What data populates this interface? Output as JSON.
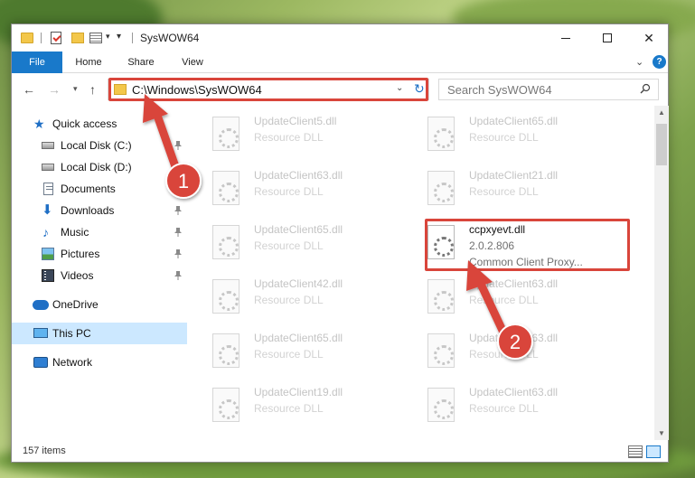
{
  "window": {
    "title": "SysWOW64"
  },
  "ribbon": {
    "tabs": [
      {
        "label": "File"
      },
      {
        "label": "Home"
      },
      {
        "label": "Share"
      },
      {
        "label": "View"
      }
    ],
    "help": "?"
  },
  "address": {
    "path": "C:\\Windows\\SysWOW64"
  },
  "search": {
    "placeholder": "Search SysWOW64"
  },
  "sidebar": {
    "items": [
      {
        "label": "Quick access",
        "icon": "star-icon"
      },
      {
        "label": "Local Disk (C:)",
        "icon": "drive-icon"
      },
      {
        "label": "Local Disk (D:)",
        "icon": "drive-icon"
      },
      {
        "label": "Documents",
        "icon": "documents-icon"
      },
      {
        "label": "Downloads",
        "icon": "download-icon"
      },
      {
        "label": "Music",
        "icon": "music-icon"
      },
      {
        "label": "Pictures",
        "icon": "pictures-icon"
      },
      {
        "label": "Videos",
        "icon": "videos-icon"
      },
      {
        "label": "OneDrive",
        "icon": "cloud-icon"
      },
      {
        "label": "This PC",
        "icon": "computer-icon",
        "selected": true
      },
      {
        "label": "Network",
        "icon": "network-icon"
      }
    ]
  },
  "files": [
    {
      "name": "UpdateClient5.dll",
      "desc": "Resource DLL"
    },
    {
      "name": "UpdateClient65.dll",
      "desc": "Resource DLL"
    },
    {
      "name": "UpdateClient63.dll",
      "desc": "Resource DLL"
    },
    {
      "name": "UpdateClient21.dll",
      "desc": "Resource DLL"
    },
    {
      "name": "UpdateClient65.dll",
      "desc": "Resource DLL"
    },
    {
      "name": "UpdateClient42.dll",
      "desc": "Resource DLL"
    },
    {
      "name": "UpdateClient63.dll",
      "desc": "Resource DLL"
    },
    {
      "name": "UpdateClient65.dll",
      "desc": "Resource DLL"
    },
    {
      "name": "UpdateClient63.dll",
      "desc": "Resource DLL"
    },
    {
      "name": "UpdateClient19.dll",
      "desc": "Resource DLL"
    },
    {
      "name": "UpdateClient63.dll",
      "desc": "Resource DLL"
    }
  ],
  "highlighted_file": {
    "name": "ccpxyevt.dll",
    "version": "2.0.2.806",
    "desc": "Common Client Proxy..."
  },
  "status": {
    "count": "157 items"
  },
  "annotations": {
    "step1": "1",
    "step2": "2",
    "color": "#d9453b"
  }
}
